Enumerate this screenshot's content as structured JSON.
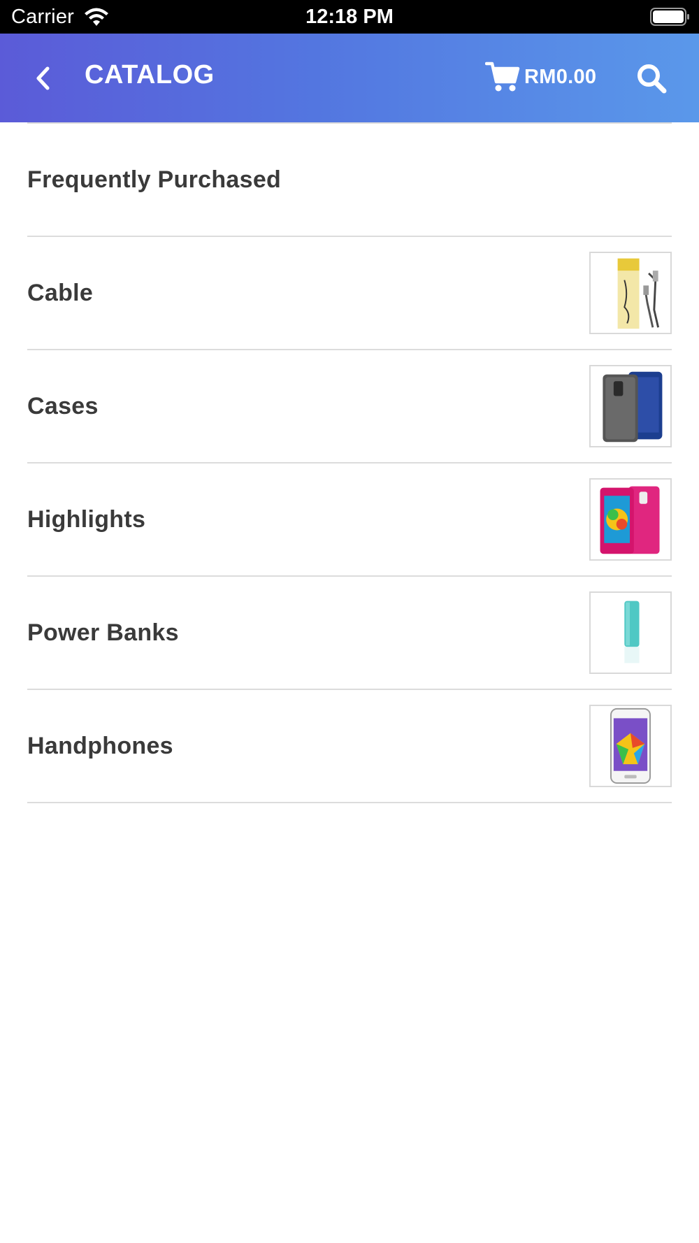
{
  "status_bar": {
    "carrier": "Carrier",
    "time": "12:18 PM"
  },
  "header": {
    "title": "CATALOG",
    "cart_total": "RM0.00",
    "icons": [
      "chevron-left-icon",
      "shopping-cart-icon",
      "search-icon"
    ]
  },
  "catalog": {
    "items": [
      {
        "label": "Frequently Purchased",
        "thumbnail": ""
      },
      {
        "label": "Cable",
        "thumbnail": "cable-product-image"
      },
      {
        "label": "Cases",
        "thumbnail": "phone-case-product-image"
      },
      {
        "label": "Highlights",
        "thumbnail": "pink-flip-case-image"
      },
      {
        "label": "Power Banks",
        "thumbnail": "power-bank-image"
      },
      {
        "label": "Handphones",
        "thumbnail": "smartphone-image"
      }
    ]
  },
  "colors": {
    "header_gradient_start": "#5b5bd8",
    "header_gradient_end": "#5a98ea",
    "divider": "#dcdcdc",
    "text": "#3a3a3a"
  }
}
